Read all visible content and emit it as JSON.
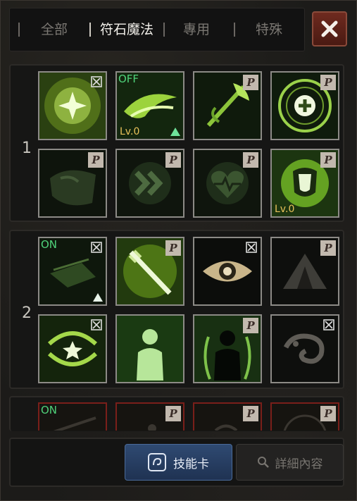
{
  "tabs": [
    {
      "label": "全部"
    },
    {
      "label": "符石魔法"
    },
    {
      "label": "專用"
    },
    {
      "label": "特殊"
    }
  ],
  "groups": [
    {
      "number": "1"
    },
    {
      "number": "2"
    }
  ],
  "slots": {
    "s1_1": {
      "badge": "x",
      "state": "",
      "level": ""
    },
    "s1_2": {
      "badge": "",
      "state": "OFF",
      "level": "Lv.0"
    },
    "s1_3": {
      "badge": "P",
      "state": "",
      "level": ""
    },
    "s1_4": {
      "badge": "P",
      "state": "",
      "level": ""
    },
    "s1_5": {
      "badge": "P",
      "state": "",
      "level": ""
    },
    "s1_6": {
      "badge": "P",
      "state": "",
      "level": ""
    },
    "s1_7": {
      "badge": "P",
      "state": "",
      "level": ""
    },
    "s1_8": {
      "badge": "P",
      "state": "",
      "level": "Lv.0"
    },
    "s2_1": {
      "badge": "x",
      "state": "ON",
      "level": ""
    },
    "s2_2": {
      "badge": "P",
      "state": "",
      "level": ""
    },
    "s2_3": {
      "badge": "x",
      "state": "",
      "level": ""
    },
    "s2_4": {
      "badge": "P",
      "state": "",
      "level": ""
    },
    "s2_5": {
      "badge": "x",
      "state": "",
      "level": ""
    },
    "s2_6": {
      "badge": "",
      "state": "",
      "level": ""
    },
    "s2_7": {
      "badge": "P",
      "state": "",
      "level": ""
    },
    "s2_8": {
      "badge": "x",
      "state": "",
      "level": ""
    },
    "s3_1": {
      "badge": "",
      "state": "ON",
      "level": ""
    },
    "s3_2": {
      "badge": "P",
      "state": "",
      "level": ""
    },
    "s3_3": {
      "badge": "P",
      "state": "",
      "level": ""
    },
    "s3_4": {
      "badge": "P",
      "state": "",
      "level": ""
    }
  },
  "buttons": {
    "skill_card": "技能卡",
    "details": "詳細內容"
  },
  "colors": {
    "glow_green": "#8ee04a",
    "active_tab": "#f1efe9",
    "close_red": "#6e2a1f",
    "skill_blue": "#2f4a72"
  }
}
